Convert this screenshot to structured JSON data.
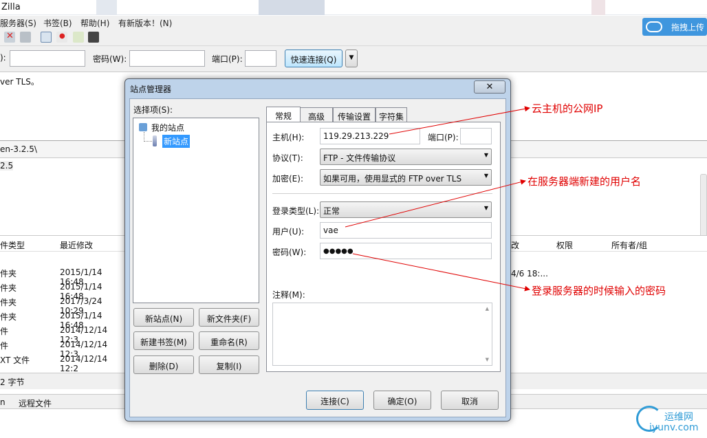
{
  "window": {
    "title": "Zilla",
    "menu": [
      "服务器(S)",
      "书签(B)",
      "帮助(H)",
      "有新版本！(N)"
    ],
    "upload_button": "拖拽上传"
  },
  "quickconnect": {
    "password_label": "密码(W):",
    "port_label": "端口(P):",
    "prefix_label": "):",
    "connect_button": "快速连接(Q)"
  },
  "log": {
    "line1": "ver TLS。"
  },
  "local_path": {
    "value": "en-3.2.5\\",
    "tree_item": "2.5"
  },
  "local_list": {
    "headers": [
      "件类型",
      "最近修改"
    ],
    "rows": [
      {
        "type": "件夹",
        "date": "2015/1/14 16:48"
      },
      {
        "type": "件夹",
        "date": "2015/1/14 16:48"
      },
      {
        "type": "件夹",
        "date": "2017/3/24 10:29"
      },
      {
        "type": "件夹",
        "date": "2015/1/14 16:48"
      },
      {
        "type": "件",
        "date": "2014/12/14 12:3"
      },
      {
        "type": "件",
        "date": "2014/12/14 12:3"
      },
      {
        "type": "XT 文件",
        "date": "2014/12/14 12:2"
      }
    ],
    "status": "2 字节"
  },
  "remote_list": {
    "headers": [
      "改",
      "权限",
      "所有者/组"
    ],
    "row1_date": "4/6 18:..."
  },
  "queue": {
    "col1": "n",
    "col2": "远程文件"
  },
  "dialog": {
    "title": "站点管理器",
    "close": "✕",
    "select_label": "选择项(S):",
    "tree_root": "我的站点",
    "tree_child": "新站点",
    "buttons": {
      "new_site": "新站点(N)",
      "new_folder": "新文件夹(F)",
      "new_bookmark": "新建书签(M)",
      "rename": "重命名(R)",
      "delete": "删除(D)",
      "copy": "复制(I)",
      "connect": "连接(C)",
      "ok": "确定(O)",
      "cancel": "取消"
    },
    "tabs": [
      "常规",
      "高级",
      "传输设置",
      "字符集"
    ],
    "host_label": "主机(H):",
    "host_value": "119.29.213.229",
    "port_label": "端口(P):",
    "protocol_label": "协议(T):",
    "protocol_value": "FTP - 文件传输协议",
    "encryption_label": "加密(E):",
    "encryption_value": "如果可用，使用显式的 FTP over TLS",
    "logon_label": "登录类型(L):",
    "logon_value": "正常",
    "user_label": "用户(U):",
    "user_value": "vae",
    "password_label": "密码(W):",
    "password_value": "●●●●●",
    "comment_label": "注释(M):"
  },
  "annotations": {
    "public_ip": "云主机的公网IP",
    "username": "在服务器端新建的用户名",
    "password": "登录服务器的时候输入的密码"
  },
  "watermark": {
    "name": "运维网",
    "url": "iyunv.com"
  },
  "colors": {
    "annotation": "#e00000",
    "dialog_frame": "#bed3ea",
    "upload_button": "#3f96de",
    "watermark": "#2f9bd6"
  }
}
